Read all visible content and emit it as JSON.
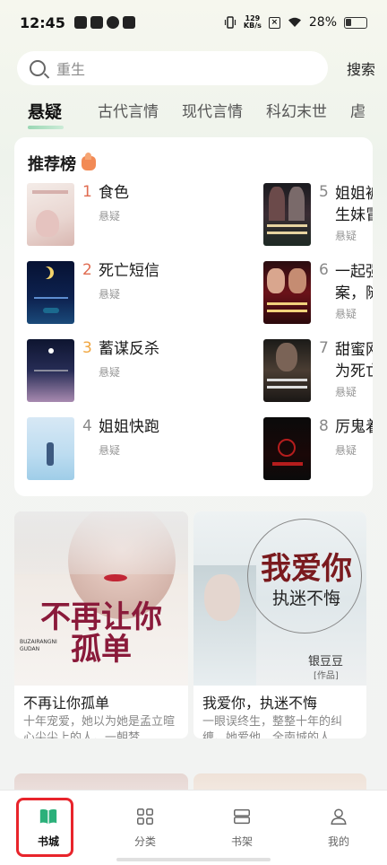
{
  "status_bar": {
    "time": "12:45",
    "speed_top": "129",
    "speed_unit": "KB/s",
    "battery": "28%"
  },
  "search": {
    "placeholder": "重生",
    "button": "搜索"
  },
  "tabs": [
    "悬疑",
    "古代言情",
    "现代言情",
    "科幻末世",
    "虐"
  ],
  "ranking": {
    "title": "推荐榜",
    "items": [
      {
        "rank": "1",
        "name": "食色",
        "category": "悬疑"
      },
      {
        "rank": "2",
        "name": "死亡短信",
        "category": "悬疑"
      },
      {
        "rank": "3",
        "name": "蓄谋反杀",
        "category": "悬疑"
      },
      {
        "rank": "4",
        "name": "姐姐快跑",
        "category": "悬疑"
      },
      {
        "rank": "5",
        "name": "姐姐被生妹冒",
        "category": "悬疑"
      },
      {
        "rank": "6",
        "name": "一起强案，随",
        "category": "悬疑"
      },
      {
        "rank": "7",
        "name": "甜蜜网为死亡",
        "category": "悬疑"
      },
      {
        "rank": "8",
        "name": "厉鬼着",
        "category": "悬疑"
      }
    ]
  },
  "books": [
    {
      "title": "不再让你孤单",
      "desc": "十年宠爱，她以为她是孟立暄心尖尖上的人。一朝梦...",
      "cover_title_line1": "不再让你",
      "cover_title_line2": "孤单",
      "cover_sub": "BUZAIRANGNI GUDAN"
    },
    {
      "title": "我爱你，执迷不悔",
      "desc": "一眼误终生，整整十年的纠缠。她爱他，全南城的人...",
      "cover_title_line1": "我爱你",
      "cover_title_line2": "执迷不悔",
      "cover_author": "银豆豆",
      "cover_author_tag": "[作品]"
    }
  ],
  "bottom_nav": [
    {
      "label": "书城",
      "icon": "open-book-icon",
      "active": true
    },
    {
      "label": "分类",
      "icon": "grid-icon",
      "active": false
    },
    {
      "label": "书架",
      "icon": "bookshelf-icon",
      "active": false
    },
    {
      "label": "我的",
      "icon": "person-icon",
      "active": false
    }
  ],
  "colors": {
    "accent_green": "#2bb07a",
    "rank_top": "#e06b50",
    "rank_third": "#f0a640",
    "highlight_red": "#e8242b"
  }
}
